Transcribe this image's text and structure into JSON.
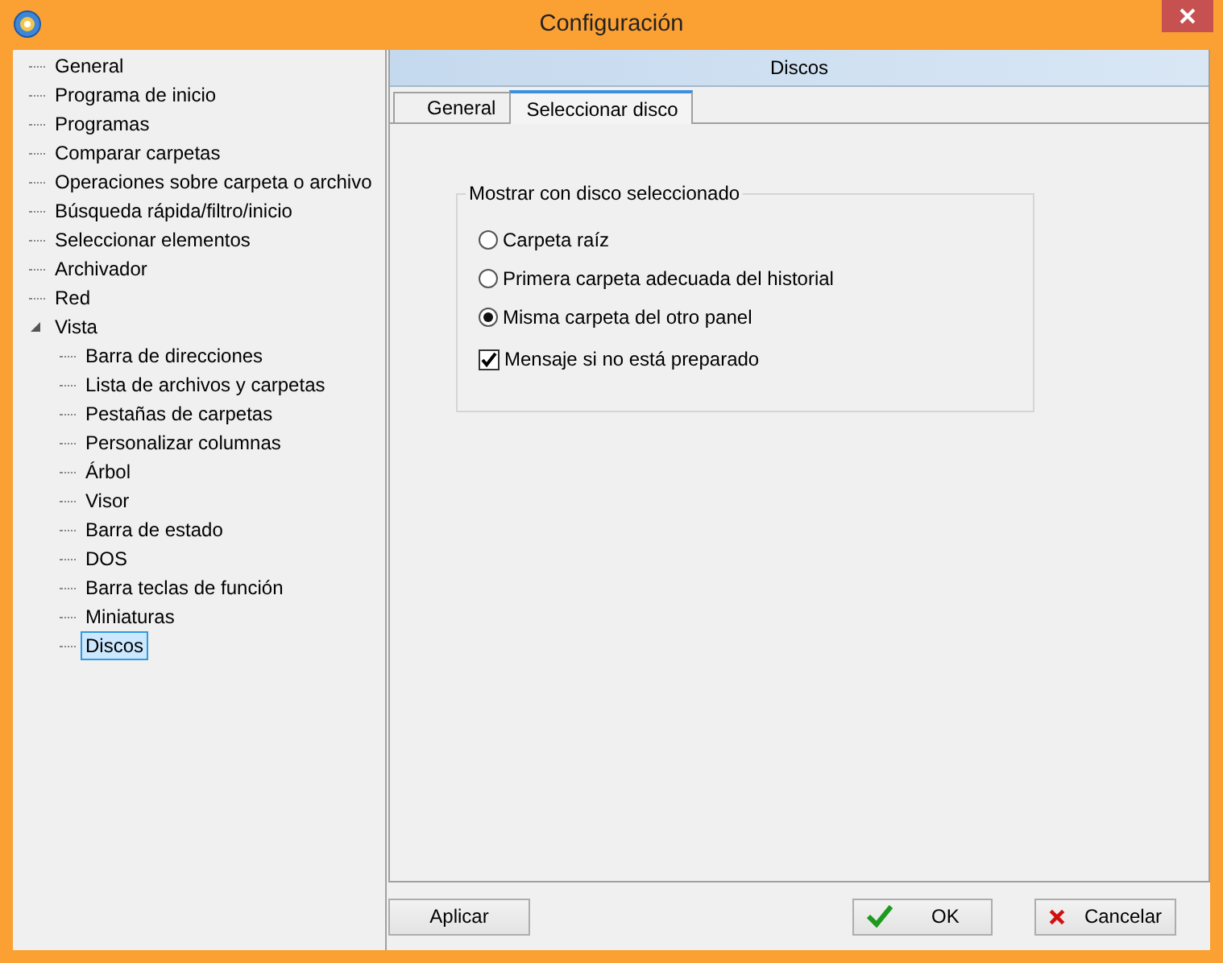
{
  "window": {
    "title": "Configuración"
  },
  "tree": [
    {
      "label": "General",
      "selected": false
    },
    {
      "label": "Programa de inicio",
      "selected": false
    },
    {
      "label": "Programas",
      "selected": false
    },
    {
      "label": "Comparar carpetas",
      "selected": false
    },
    {
      "label": "Operaciones sobre carpeta o archivo",
      "selected": false
    },
    {
      "label": "Búsqueda rápida/filtro/inicio",
      "selected": false
    },
    {
      "label": "Seleccionar elementos",
      "selected": false
    },
    {
      "label": "Archivador",
      "selected": false
    },
    {
      "label": "Red",
      "selected": false
    },
    {
      "label": "Vista",
      "selected": false,
      "expanded": true,
      "children": [
        {
          "label": "Barra de direcciones",
          "selected": false
        },
        {
          "label": "Lista de archivos y carpetas",
          "selected": false
        },
        {
          "label": "Pestañas de carpetas",
          "selected": false
        },
        {
          "label": "Personalizar columnas",
          "selected": false
        },
        {
          "label": "Árbol",
          "selected": false
        },
        {
          "label": "Visor",
          "selected": false
        },
        {
          "label": "Barra de estado",
          "selected": false
        },
        {
          "label": "DOS",
          "selected": false
        },
        {
          "label": "Barra teclas de función",
          "selected": false
        },
        {
          "label": "Miniaturas",
          "selected": false
        },
        {
          "label": "Discos",
          "selected": true
        }
      ]
    }
  ],
  "panel": {
    "title": "Discos"
  },
  "tabs": [
    {
      "label": "General",
      "selected": false
    },
    {
      "label": "Seleccionar disco",
      "selected": true
    }
  ],
  "group": {
    "title": "Mostrar con disco seleccionado",
    "options": [
      {
        "kind": "radio",
        "label": "Carpeta raíz",
        "checked": false
      },
      {
        "kind": "radio",
        "label": "Primera carpeta adecuada del historial",
        "checked": false
      },
      {
        "kind": "radio",
        "label": "Misma carpeta del otro panel",
        "checked": true
      },
      {
        "kind": "checkbox",
        "label": "Mensaje si no está preparado",
        "checked": true
      }
    ]
  },
  "buttons": [
    {
      "kind": "apply",
      "label": "Aplicar"
    },
    {
      "kind": "ok",
      "label": "OK"
    },
    {
      "kind": "cancel",
      "label": "Cancelar"
    }
  ]
}
